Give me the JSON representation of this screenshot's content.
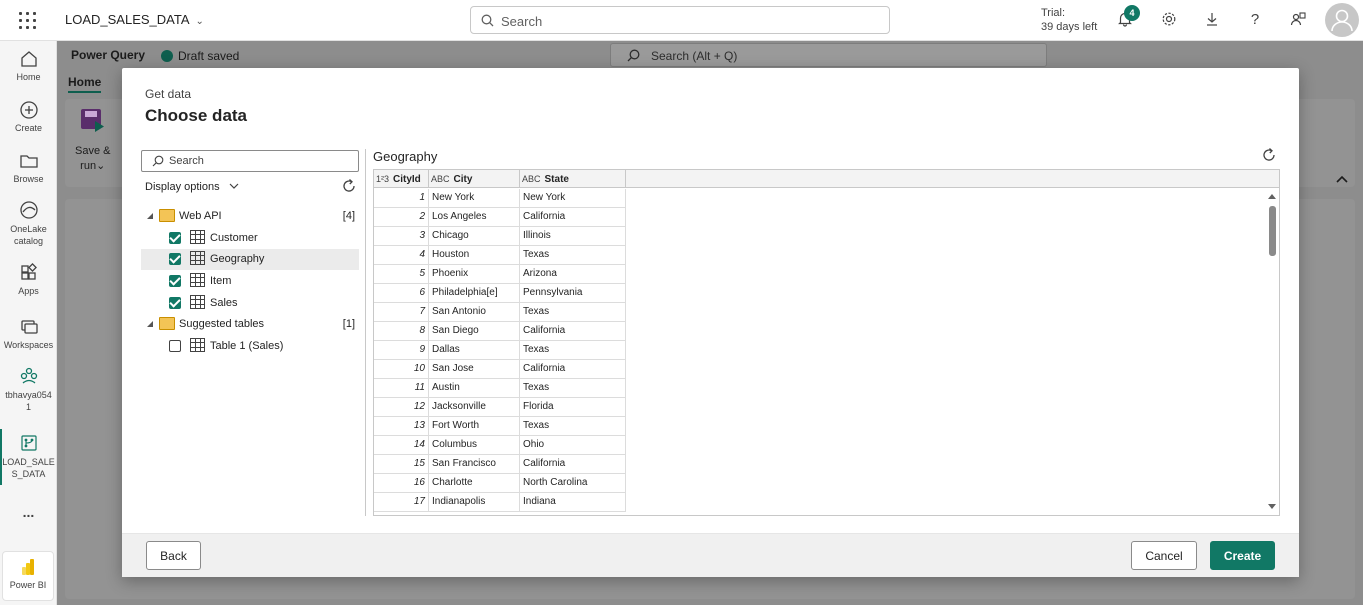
{
  "topbar": {
    "app_title": "LOAD_SALES_DATA",
    "search_placeholder": "Search",
    "trial_line1": "Trial:",
    "trial_line2": "39 days left",
    "notification_count": "4"
  },
  "rail": {
    "items": [
      {
        "label": "Home"
      },
      {
        "label": "Create"
      },
      {
        "label": "Browse"
      },
      {
        "label": "OneLake",
        "label2": "catalog"
      },
      {
        "label": "Apps"
      },
      {
        "label": "Workspaces"
      },
      {
        "label": "tbhavya054",
        "label2": "1"
      },
      {
        "label": "LOAD_SALE",
        "label2": "S_DATA"
      },
      {
        "label": "..."
      },
      {
        "label": "Power BI"
      }
    ]
  },
  "background": {
    "title": "Power Query",
    "draft": "Draft saved",
    "search_placeholder": "Search (Alt + Q)",
    "home_tab": "Home",
    "save_label1": "Save &",
    "save_label2": "run"
  },
  "dialog": {
    "subtitle": "Get data",
    "title": "Choose data",
    "search_placeholder": "Search",
    "display_options": "Display options",
    "tree": {
      "web_api": {
        "label": "Web API",
        "count": "[4]"
      },
      "tables": [
        {
          "label": "Customer",
          "checked": true
        },
        {
          "label": "Geography",
          "checked": true
        },
        {
          "label": "Item",
          "checked": true
        },
        {
          "label": "Sales",
          "checked": true
        }
      ],
      "suggested": {
        "label": "Suggested tables",
        "count": "[1]"
      },
      "suggested_tables": [
        {
          "label": "Table 1 (Sales)",
          "checked": false
        }
      ]
    },
    "preview": {
      "title": "Geography",
      "columns": [
        {
          "type": "1²3",
          "name": "CityId"
        },
        {
          "type": "ABC",
          "name": "City"
        },
        {
          "type": "ABC",
          "name": "State"
        }
      ],
      "rows": [
        [
          "1",
          "New York",
          "New York"
        ],
        [
          "2",
          "Los Angeles",
          "California"
        ],
        [
          "3",
          "Chicago",
          "Illinois"
        ],
        [
          "4",
          "Houston",
          "Texas"
        ],
        [
          "5",
          "Phoenix",
          "Arizona"
        ],
        [
          "6",
          "Philadelphia[e]",
          "Pennsylvania"
        ],
        [
          "7",
          "San Antonio",
          "Texas"
        ],
        [
          "8",
          "San Diego",
          "California"
        ],
        [
          "9",
          "Dallas",
          "Texas"
        ],
        [
          "10",
          "San Jose",
          "California"
        ],
        [
          "11",
          "Austin",
          "Texas"
        ],
        [
          "12",
          "Jacksonville",
          "Florida"
        ],
        [
          "13",
          "Fort Worth",
          "Texas"
        ],
        [
          "14",
          "Columbus",
          "Ohio"
        ],
        [
          "15",
          "San Francisco",
          "California"
        ],
        [
          "16",
          "Charlotte",
          "North Carolina"
        ],
        [
          "17",
          "Indianapolis",
          "Indiana"
        ]
      ]
    },
    "buttons": {
      "back": "Back",
      "cancel": "Cancel",
      "create": "Create"
    }
  },
  "colors": {
    "accent": "#117865"
  }
}
